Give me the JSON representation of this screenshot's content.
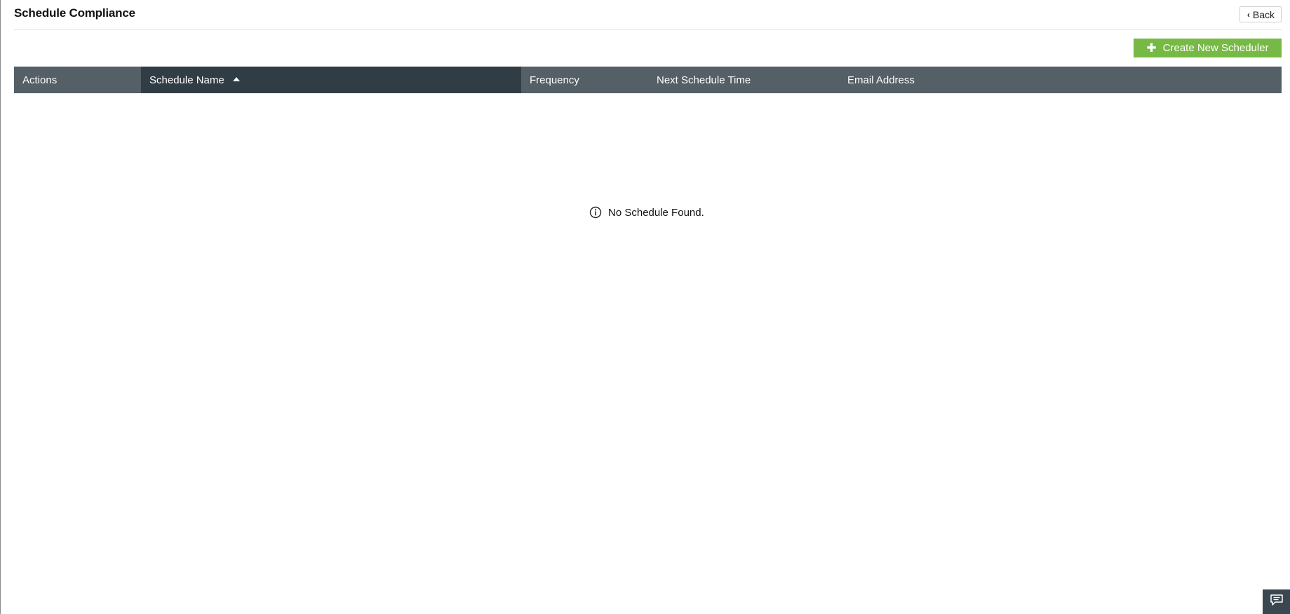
{
  "header": {
    "title": "Schedule Compliance",
    "back_label": "Back"
  },
  "toolbar": {
    "create_label": "Create New Scheduler"
  },
  "table": {
    "columns": [
      {
        "label": "Actions"
      },
      {
        "label": "Schedule Name",
        "sorted": "ascending"
      },
      {
        "label": "Frequency"
      },
      {
        "label": "Next Schedule Time"
      },
      {
        "label": "Email Address"
      }
    ],
    "rows": [],
    "empty_message": "No Schedule Found."
  },
  "colors": {
    "accent_green": "#76b945",
    "header_bg": "#545f66",
    "sorted_header_bg": "#313d45"
  },
  "icons": {
    "back": "chevron-left-icon",
    "create": "plus-icon",
    "sort": "sort-ascending-icon",
    "empty": "info-icon",
    "chat": "chat-icon"
  }
}
